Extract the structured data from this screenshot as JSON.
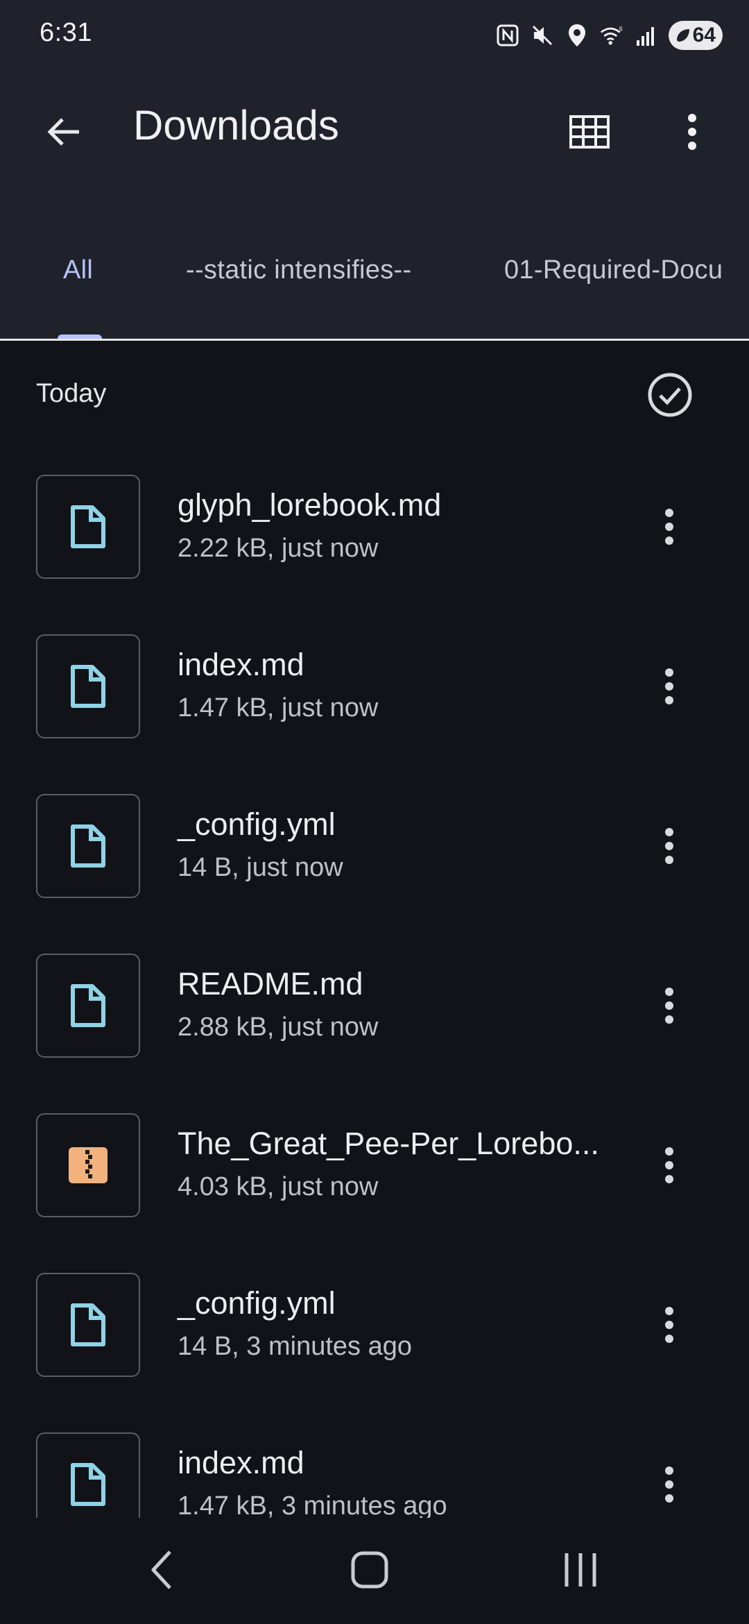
{
  "status_bar": {
    "time": "6:31",
    "battery": "64",
    "icons": [
      "nfc-icon",
      "mute-icon",
      "location-icon",
      "wifi-6-icon",
      "signal-icon",
      "battery-saver-icon"
    ]
  },
  "app_bar": {
    "title": "Downloads",
    "back_icon": "arrow-left-icon",
    "view_toggle_icon": "grid-view-icon",
    "more_icon": "more-vert-icon"
  },
  "tabs": [
    {
      "label": "All",
      "active": true
    },
    {
      "label": "--static intensifies--",
      "active": false
    },
    {
      "label": "01-Required-Docu",
      "active": false
    }
  ],
  "colors": {
    "accent": "#b7c3ff",
    "doc_icon": "#8fd3e6",
    "archive_icon": "#f2b27e",
    "background": "#121318",
    "header": "#1f222a"
  },
  "section": {
    "title": "Today",
    "select_icon": "check-circle-icon"
  },
  "files": [
    {
      "name": "glyph_lorebook.md",
      "meta": "2.22 kB, just now",
      "icon": "document-icon"
    },
    {
      "name": "index.md",
      "meta": "1.47 kB, just now",
      "icon": "document-icon"
    },
    {
      "name": "_config.yml",
      "meta": "14 B, just now",
      "icon": "document-icon"
    },
    {
      "name": "README.md",
      "meta": "2.88 kB, just now",
      "icon": "document-icon"
    },
    {
      "name": "The_Great_Pee-Per_Lorebo...",
      "meta": "4.03 kB, just now",
      "icon": "zip-archive-icon"
    },
    {
      "name": "_config.yml",
      "meta": "14 B, 3 minutes ago",
      "icon": "document-icon"
    },
    {
      "name": "index.md",
      "meta": "1.47 kB, 3 minutes ago",
      "icon": "document-icon"
    }
  ],
  "nav_bar": {
    "back_icon": "nav-back-icon",
    "home_icon": "nav-home-icon",
    "recents_icon": "nav-recents-icon"
  }
}
